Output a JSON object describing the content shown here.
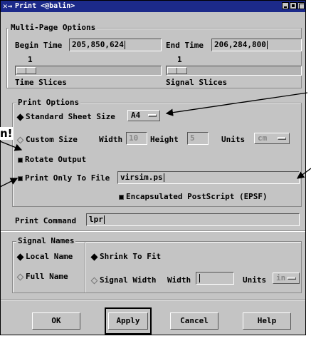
{
  "window": {
    "title": "Print <@balin>"
  },
  "multi_page": {
    "label": "Multi-Page Options",
    "begin_label": "Begin Time",
    "begin_value": "205,850,624",
    "end_label": "End Time",
    "end_value": "206,284,800",
    "time_slices_value": "1",
    "time_slices_label": "Time Slices",
    "signal_slices_value": "1",
    "signal_slices_label": "Signal Slices"
  },
  "print_options": {
    "label": "Print Options",
    "standard_label": "Standard Sheet Size",
    "standard_value": "A4",
    "custom_label": "Custom Size",
    "width_label": "Width",
    "width_value": "10",
    "height_label": "Height",
    "height_value": "5",
    "units_label": "Units",
    "units_value": "cm",
    "rotate_label": "Rotate Output",
    "print_file_label": "Print Only To File",
    "file_value": "virsim.ps",
    "eps_label": "Encapsulated PostScript (EPSF)"
  },
  "print_command": {
    "label": "Print Command",
    "value": "lpr"
  },
  "signal_names": {
    "label": "Signal Names",
    "local_label": "Local Name",
    "full_label": "Full Name",
    "shrink_label": "Shrink To Fit",
    "signal_width_label": "Signal Width",
    "width_label": "Width",
    "units_label": "Units",
    "units_value": "in"
  },
  "buttons": {
    "ok": "OK",
    "apply": "Apply",
    "cancel": "Cancel",
    "help": "Help"
  },
  "outside": {
    "fragment": "n!"
  }
}
